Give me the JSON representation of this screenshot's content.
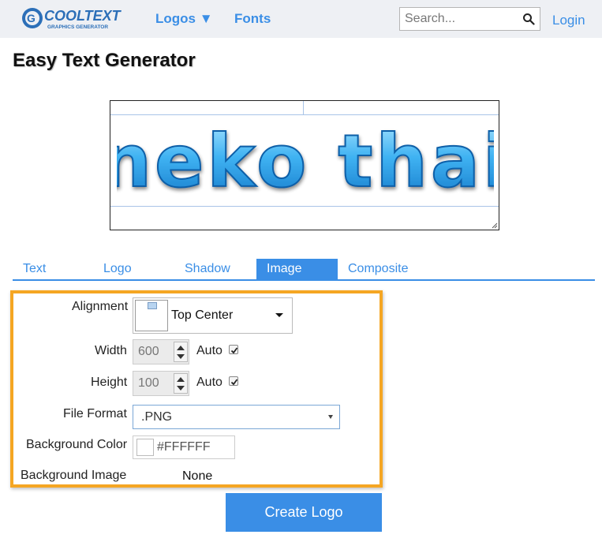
{
  "header": {
    "logo_text": "COOLTEXT",
    "logo_subtext": "GRAPHICS GENERATOR",
    "nav_logos": "Logos ▼",
    "nav_fonts": "Fonts",
    "search_placeholder": "Search...",
    "login": "Login"
  },
  "page": {
    "title": "Easy Text Generator"
  },
  "preview": {
    "logo_text": "neko thai",
    "logo_color": "#3aa8ee"
  },
  "tabs": {
    "text": "Text",
    "logo": "Logo",
    "shadow": "Shadow",
    "image": "Image",
    "composite": "Composite",
    "active": "Image"
  },
  "form": {
    "alignment_label": "Alignment",
    "alignment_value": "Top Center",
    "width_label": "Width",
    "width_value": "600",
    "width_auto_label": "Auto",
    "width_auto_checked": true,
    "height_label": "Height",
    "height_value": "100",
    "height_auto_label": "Auto",
    "height_auto_checked": true,
    "file_format_label": "File Format",
    "file_format_value": ".PNG",
    "bg_color_label": "Background Color",
    "bg_color_value": "#FFFFFF",
    "bg_image_label": "Background Image",
    "bg_image_value": "None"
  },
  "actions": {
    "create_logo": "Create Logo"
  },
  "colors": {
    "accent": "#3a8ee6",
    "highlight_border": "#f5a623"
  }
}
